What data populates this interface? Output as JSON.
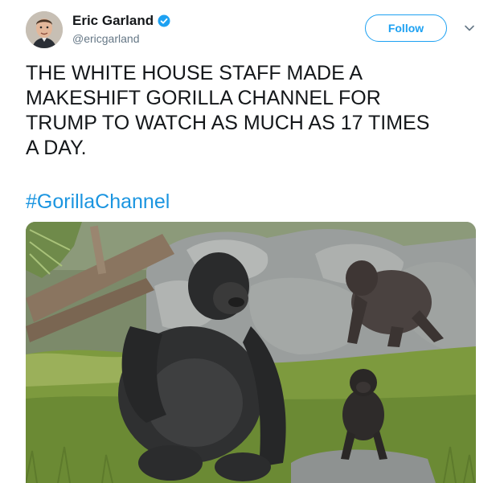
{
  "author": {
    "name": "Eric Garland",
    "handle": "@ericgarland",
    "verified": true,
    "avatar": "avatar-photo"
  },
  "actions": {
    "follow_label": "Follow",
    "menu_icon": "chevron-down-icon"
  },
  "tweet": {
    "text": "THE WHITE HOUSE STAFF MADE A\nMAKESHIFT GORILLA CHANNEL FOR\nTRUMP TO WATCH AS MUCH AS 17 TIMES\nA DAY.",
    "hashtag": "#GorillaChannel"
  },
  "media": {
    "type": "photo",
    "subject": "gorillas"
  },
  "colors": {
    "accent": "#1da1f2",
    "hashtag": "#1b95e0",
    "text": "#14171a",
    "secondary": "#657786"
  }
}
